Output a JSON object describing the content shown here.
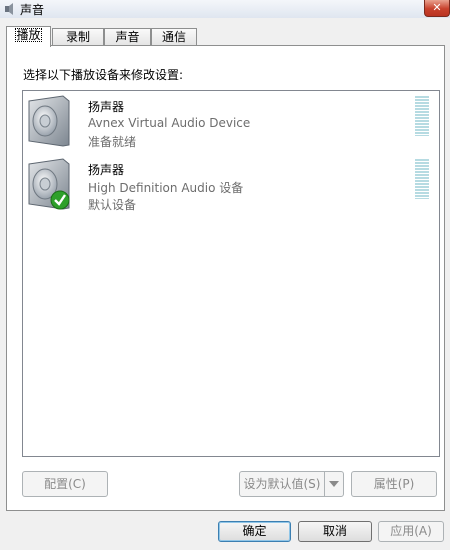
{
  "window": {
    "title": "声音",
    "close_glyph": "✕"
  },
  "tabs": [
    {
      "label": "播放",
      "active": true
    },
    {
      "label": "录制",
      "active": false
    },
    {
      "label": "声音",
      "active": false
    },
    {
      "label": "通信",
      "active": false
    }
  ],
  "instruction": "选择以下播放设备来修改设置:",
  "devices": [
    {
      "name": "扬声器",
      "description": "Avnex Virtual Audio Device",
      "status": "准备就绪",
      "icon": "speaker-icon",
      "default": false
    },
    {
      "name": "扬声器",
      "description": "High Definition Audio 设备",
      "status": "默认设备",
      "icon": "speaker-icon",
      "default": true
    }
  ],
  "buttons": {
    "configure": "配置(C)",
    "set_default": "设为默认值(S)",
    "properties": "属性(P)",
    "ok": "确定",
    "cancel": "取消",
    "apply": "应用(A)"
  },
  "colors": {
    "default_check": "#2ea02a",
    "meter": "#b6dbe2"
  }
}
